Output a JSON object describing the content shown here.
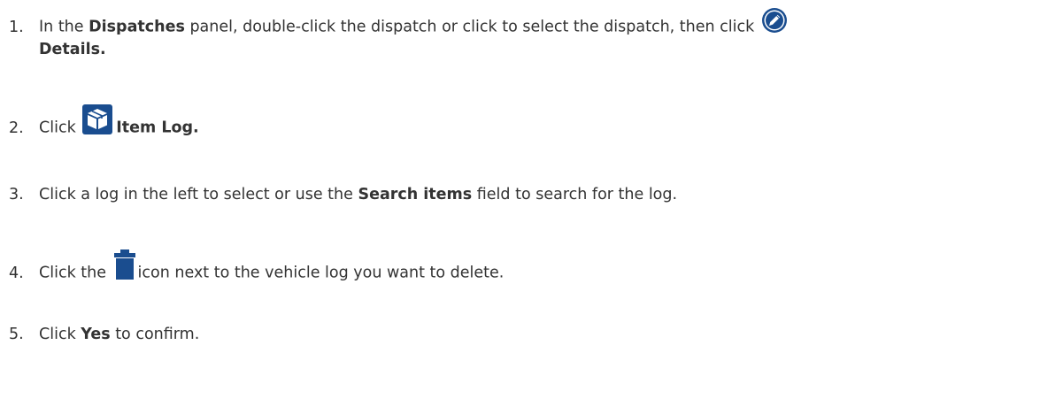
{
  "steps": [
    {
      "number": "1.",
      "parts": {
        "a": "In the ",
        "b": "Dispatches",
        "c": " panel, double-click the dispatch or click to select the dispatch, then click",
        "d": "Details."
      },
      "icon": "edit-pencil-icon"
    },
    {
      "number": "2.",
      "parts": {
        "a": "Click",
        "b": "Item Log."
      },
      "icon": "box-icon"
    },
    {
      "number": "3.",
      "parts": {
        "a": "Click a log in the left to select or use the ",
        "b": "Search items",
        "c": " field to search for the log."
      }
    },
    {
      "number": "4.",
      "parts": {
        "a": "Click the ",
        "b": "icon next to the vehicle log you want to delete."
      },
      "icon": "trash-icon"
    },
    {
      "number": "5.",
      "parts": {
        "a": "Click ",
        "b": "Yes",
        "c": " to confirm."
      }
    }
  ],
  "colors": {
    "text": "#333333",
    "icon_blue": "#1a4d8f"
  }
}
